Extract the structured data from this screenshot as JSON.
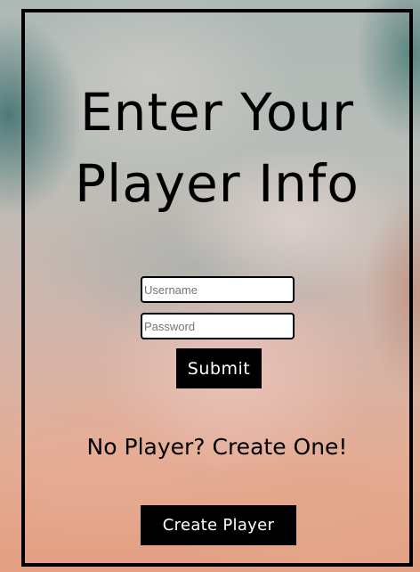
{
  "form": {
    "title_line1": "Enter Your",
    "title_line2": "Player Info",
    "username": {
      "placeholder": "Username",
      "value": ""
    },
    "password": {
      "placeholder": "Password",
      "value": ""
    },
    "submit_label": "Submit"
  },
  "signup": {
    "prompt": "No Player? Create One!",
    "create_label": "Create Player"
  },
  "colors": {
    "frame_border": "#000000",
    "button_bg": "#000000",
    "button_text": "#ffffff"
  }
}
